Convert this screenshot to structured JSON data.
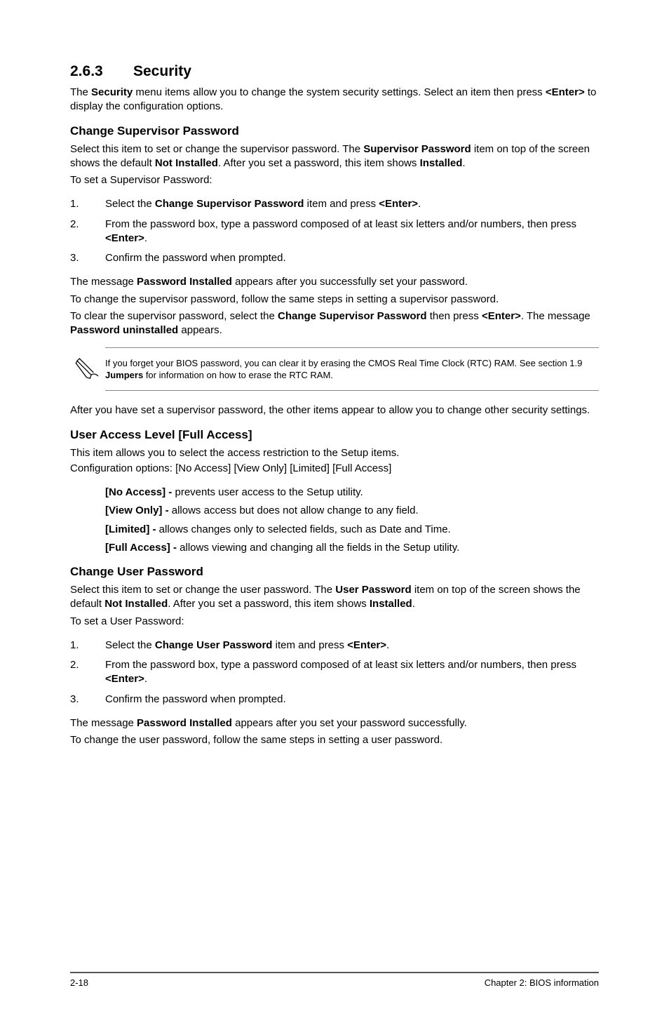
{
  "section": {
    "number": "2.6.3",
    "title": "Security",
    "intro_pre": "The ",
    "intro_bold1": "Security",
    "intro_mid": " menu items allow you to change the system security settings. Select an item then press ",
    "intro_bold2": "<Enter>",
    "intro_post": " to display the configuration options."
  },
  "csp": {
    "heading": "Change Supervisor Password",
    "p1_a": "Select this item to set or change the supervisor password. The ",
    "p1_b": "Supervisor Password",
    "p1_c": " item on top of the screen shows the default ",
    "p1_d": "Not Installed",
    "p1_e": ". After you set a password, this item shows ",
    "p1_f": "Installed",
    "p1_g": ".",
    "p2": "To set a Supervisor Password:",
    "steps": [
      {
        "n": "1.",
        "a": "Select the ",
        "b": "Change Supervisor Password",
        "c": " item and press ",
        "d": "<Enter>",
        "e": "."
      },
      {
        "n": "2.",
        "a": "From the password box, type a password composed of at least six letters and/or numbers, then press ",
        "b": "<Enter>",
        "c": "."
      },
      {
        "n": "3.",
        "a": "Confirm the password when prompted."
      }
    ],
    "after1_a": "The message ",
    "after1_b": "Password Installed",
    "after1_c": " appears after you successfully set your password.",
    "after2": "To change the supervisor password, follow the same steps in setting a supervisor password.",
    "after3_a": "To clear the supervisor password, select the ",
    "after3_b": "Change Supervisor Password",
    "after3_c": " then press ",
    "after3_d": "<Enter>",
    "after3_e": ". The message ",
    "after3_f": "Password uninstalled",
    "after3_g": " appears."
  },
  "note": {
    "text_a": "If you forget your BIOS password, you can clear it by erasing the CMOS Real Time Clock (RTC) RAM. See section 1.9 ",
    "text_b": "Jumpers",
    "text_c": " for information on how to erase the RTC RAM."
  },
  "after_note": "After you have set a supervisor password, the other items appear to allow you to change other security settings.",
  "ual": {
    "heading": "User Access Level [Full Access]",
    "p1": "This item allows you to select the access restriction to the Setup items.",
    "p2": "Configuration options: [No Access] [View Only] [Limited] [Full Access]",
    "opts": [
      {
        "b": "[No Access] - ",
        "t": "prevents user access to the Setup utility."
      },
      {
        "b": "[View Only] - ",
        "t": "allows access but does not allow change to any field."
      },
      {
        "b": "[Limited] - ",
        "t": "allows changes only to selected fields, such as Date and Time."
      },
      {
        "b": "[Full Access] - ",
        "t": "allows viewing and changing all the fields in the Setup utility."
      }
    ]
  },
  "cup": {
    "heading": "Change User Password",
    "p1_a": "Select this item to set or change the user password. The ",
    "p1_b": "User Password",
    "p1_c": " item on top of the screen shows the default ",
    "p1_d": "Not Installed",
    "p1_e": ". After you set a password, this item shows ",
    "p1_f": "Installed",
    "p1_g": ".",
    "p2": "To set a User Password:",
    "steps": [
      {
        "n": "1.",
        "a": "Select the ",
        "b": "Change User Password",
        "c": " item and press ",
        "d": "<Enter>",
        "e": "."
      },
      {
        "n": "2.",
        "a": "From the password box, type a password composed of at least six letters and/or numbers, then press ",
        "b": "<Enter>",
        "c": "."
      },
      {
        "n": "3.",
        "a": "Confirm the password when prompted."
      }
    ],
    "after1_a": "The message ",
    "after1_b": "Password Installed",
    "after1_c": " appears after you set your password successfully.",
    "after2": "To change the user password, follow the same steps in setting a user password."
  },
  "footer": {
    "left": "2-18",
    "right": "Chapter 2: BIOS information"
  }
}
